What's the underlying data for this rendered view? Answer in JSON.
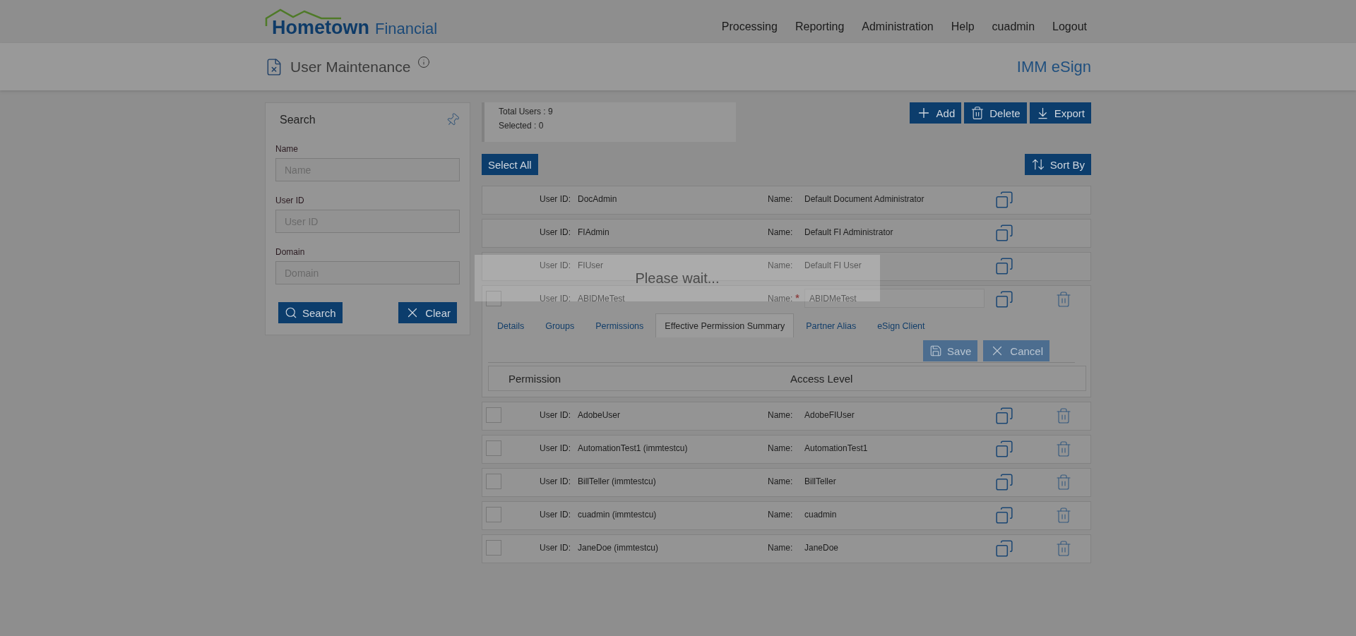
{
  "header": {
    "logo": {
      "brand": "Hometown",
      "sub": "Financial"
    },
    "nav": [
      "Processing",
      "Reporting",
      "Administration",
      "Help",
      "cuadmin",
      "Logout"
    ]
  },
  "subheader": {
    "title": "User Maintenance",
    "app_name": "IMM eSign"
  },
  "search_panel": {
    "title": "Search",
    "fields": [
      {
        "label": "Name",
        "placeholder": "Name"
      },
      {
        "label": "User ID",
        "placeholder": "User ID"
      },
      {
        "label": "Domain",
        "placeholder": "Domain"
      }
    ],
    "buttons": [
      {
        "kind": "search",
        "label": "Search"
      },
      {
        "kind": "clear",
        "label": "Clear"
      }
    ]
  },
  "summary": {
    "total": "Total Users : 9",
    "selected": "Selected : 0"
  },
  "toolbar": [
    {
      "kind": "add",
      "label": "Add"
    },
    {
      "kind": "delete",
      "label": "Delete"
    },
    {
      "kind": "export",
      "label": "Export"
    }
  ],
  "select_all": "Select All",
  "sort": "Sort By",
  "users": [
    {
      "id_label": "User ID:",
      "user_id": "DocAdmin",
      "name_label": "Name:",
      "name": "Default Document Administrator",
      "selectable": false,
      "expanded": false
    },
    {
      "id_label": "User ID:",
      "user_id": "FIAdmin",
      "name_label": "Name:",
      "name": "Default FI Administrator",
      "selectable": false,
      "expanded": false
    },
    {
      "id_label": "User ID:",
      "user_id": "FIUser",
      "name_label": "Name:",
      "name": "Default FI User",
      "selectable": false,
      "expanded": false
    },
    {
      "id_label": "User ID:",
      "user_id": "ABIDMeTest",
      "name_label": "Name:",
      "required_mark": "*",
      "name": "ABIDMeTest",
      "selectable": true,
      "checked": false,
      "expanded": true,
      "tabs": [
        {
          "label": "Details",
          "selected": false
        },
        {
          "label": "Groups",
          "selected": false
        },
        {
          "label": "Permissions",
          "selected": false
        },
        {
          "label": "Effective Permission Summary",
          "selected": true
        },
        {
          "label": "Partner Alias",
          "selected": false
        },
        {
          "label": "eSign Client",
          "selected": false
        }
      ],
      "actions": [
        {
          "kind": "save",
          "label": "Save"
        },
        {
          "kind": "cancel",
          "label": "Cancel"
        }
      ],
      "columns": [
        "Permission",
        "Access Level"
      ]
    },
    {
      "id_label": "User ID:",
      "user_id": "AdobeUser",
      "name_label": "Name:",
      "name": "AdobeFIUser",
      "selectable": true,
      "checked": false,
      "expanded": false
    },
    {
      "id_label": "User ID:",
      "user_id": "AutomationTest1 (immtestcu)",
      "name_label": "Name:",
      "name": "AutomationTest1",
      "selectable": true,
      "checked": false,
      "expanded": false
    },
    {
      "id_label": "User ID:",
      "user_id": "BillTeller (immtestcu)",
      "name_label": "Name:",
      "name": "BillTeller",
      "selectable": true,
      "checked": false,
      "expanded": false
    },
    {
      "id_label": "User ID:",
      "user_id": "cuadmin (immtestcu)",
      "name_label": "Name:",
      "name": "cuadmin",
      "selectable": true,
      "checked": false,
      "expanded": false
    },
    {
      "id_label": "User ID:",
      "user_id": "JaneDoe (immtestcu)",
      "name_label": "Name:",
      "name": "JaneDoe",
      "selectable": true,
      "checked": false,
      "expanded": false
    }
  ],
  "loading_overlay": {
    "text": "Please wait..."
  }
}
